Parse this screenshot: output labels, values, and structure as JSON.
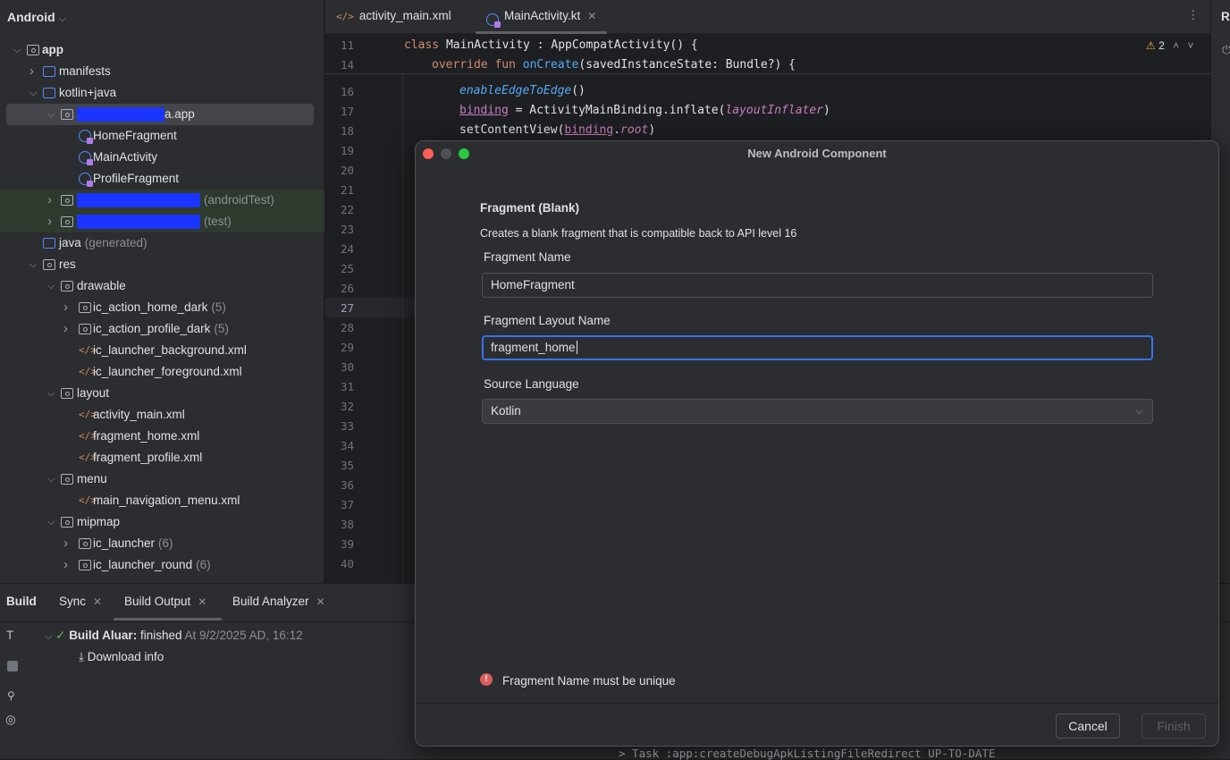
{
  "sidebar": {
    "title": "Android",
    "tree": [
      {
        "label": "app",
        "level": 0,
        "chevron": "down",
        "icon": "module",
        "bold": true
      },
      {
        "label": "manifests",
        "level": 1,
        "chevron": "right",
        "icon": "folder"
      },
      {
        "label": "kotlin+java",
        "level": 1,
        "chevron": "down",
        "icon": "folder"
      },
      {
        "label": "a.app",
        "level": 2,
        "chevron": "down",
        "icon": "package",
        "redacted": true,
        "selected": true
      },
      {
        "label": "HomeFragment",
        "level": 3,
        "icon": "kotlin-class"
      },
      {
        "label": "MainActivity",
        "level": 3,
        "icon": "kotlin-class"
      },
      {
        "label": "ProfileFragment",
        "level": 3,
        "icon": "kotlin-class"
      },
      {
        "label": "",
        "suffix": "(androidTest)",
        "level": 2,
        "chevron": "right",
        "icon": "package",
        "redacted": true,
        "test": true
      },
      {
        "label": "",
        "suffix": "(test)",
        "level": 2,
        "chevron": "right",
        "icon": "package",
        "redacted": true,
        "test": true
      },
      {
        "label": "java",
        "suffix": "(generated)",
        "level": 1,
        "icon": "folder"
      },
      {
        "label": "res",
        "level": 1,
        "chevron": "down",
        "icon": "res-folder"
      },
      {
        "label": "drawable",
        "level": 2,
        "chevron": "down",
        "icon": "package"
      },
      {
        "label": "ic_action_home_dark",
        "suffix": "(5)",
        "level": 3,
        "chevron": "right",
        "icon": "package"
      },
      {
        "label": "ic_action_profile_dark",
        "suffix": "(5)",
        "level": 3,
        "chevron": "right",
        "icon": "package"
      },
      {
        "label": "ic_launcher_background.xml",
        "level": 3,
        "icon": "xml"
      },
      {
        "label": "ic_launcher_foreground.xml",
        "level": 3,
        "icon": "xml"
      },
      {
        "label": "layout",
        "level": 2,
        "chevron": "down",
        "icon": "package"
      },
      {
        "label": "activity_main.xml",
        "level": 3,
        "icon": "xml"
      },
      {
        "label": "fragment_home.xml",
        "level": 3,
        "icon": "xml"
      },
      {
        "label": "fragment_profile.xml",
        "level": 3,
        "icon": "xml"
      },
      {
        "label": "menu",
        "level": 2,
        "chevron": "down",
        "icon": "package"
      },
      {
        "label": "main_navigation_menu.xml",
        "level": 3,
        "icon": "xml"
      },
      {
        "label": "mipmap",
        "level": 2,
        "chevron": "down",
        "icon": "package"
      },
      {
        "label": "ic_launcher",
        "suffix": "(6)",
        "level": 3,
        "chevron": "right",
        "icon": "package"
      },
      {
        "label": "ic_launcher_round",
        "suffix": "(6)",
        "level": 3,
        "chevron": "right",
        "icon": "package"
      }
    ]
  },
  "editor": {
    "tabs": [
      {
        "label": "activity_main.xml",
        "icon": "xml"
      },
      {
        "label": "MainActivity.kt",
        "icon": "kotlin-class",
        "active": true,
        "closable": true
      }
    ],
    "sticky_lines": [
      {
        "num": "11",
        "code": "class MainActivity : AppCompatActivity() {"
      },
      {
        "num": "14",
        "code": "override fun onCreate(savedInstanceState: Bundle?) {"
      }
    ],
    "lines": [
      "16",
      "17",
      "18",
      "19",
      "20",
      "21",
      "22",
      "23",
      "24",
      "25",
      "26",
      "27",
      "28",
      "29",
      "30",
      "31",
      "32",
      "33",
      "34",
      "35",
      "36",
      "37",
      "38",
      "39",
      "40"
    ],
    "code": {
      "l16": "enableEdgeToEdge",
      "l16b": "()",
      "l17a": "binding",
      "l17b": " = ActivityMainBinding.inflate(",
      "l17c": "layoutInflater",
      "l17d": ")",
      "l18a": "setContentView(",
      "l18b": "binding",
      "l18c": ".",
      "l18d": "root",
      "l18e": ")"
    },
    "warnings": "2",
    "current_line": "27",
    "right_panel_label": "R"
  },
  "build": {
    "tabs": [
      {
        "label": "Build"
      },
      {
        "label": "Sync",
        "closable": true
      },
      {
        "label": "Build Output",
        "closable": true,
        "active": true
      },
      {
        "label": "Build Analyzer",
        "closable": true
      }
    ],
    "status_bold": "Build Aluar:",
    "status": "finished",
    "timestamp": "At 9/2/2025 AD, 16:12",
    "download": "Download info",
    "log_line": "> Task :app:createDebugApkListingFileRedirect UP-TO-DATE"
  },
  "dialog": {
    "title": "New Android Component",
    "heading": "Fragment (Blank)",
    "description": "Creates a blank fragment that is compatible back to API level 16",
    "fragment_name_label": "Fragment Name",
    "fragment_name": "HomeFragment",
    "layout_name_label": "Fragment Layout Name",
    "layout_name": "fragment_home",
    "language_label": "Source Language",
    "language": "Kotlin",
    "error": "Fragment Name must be unique",
    "cancel": "Cancel",
    "finish": "Finish",
    "colors": {
      "accent": "#3574f0",
      "error": "#db5c5c",
      "close": "#ff5f57",
      "zoom": "#28c840"
    }
  }
}
